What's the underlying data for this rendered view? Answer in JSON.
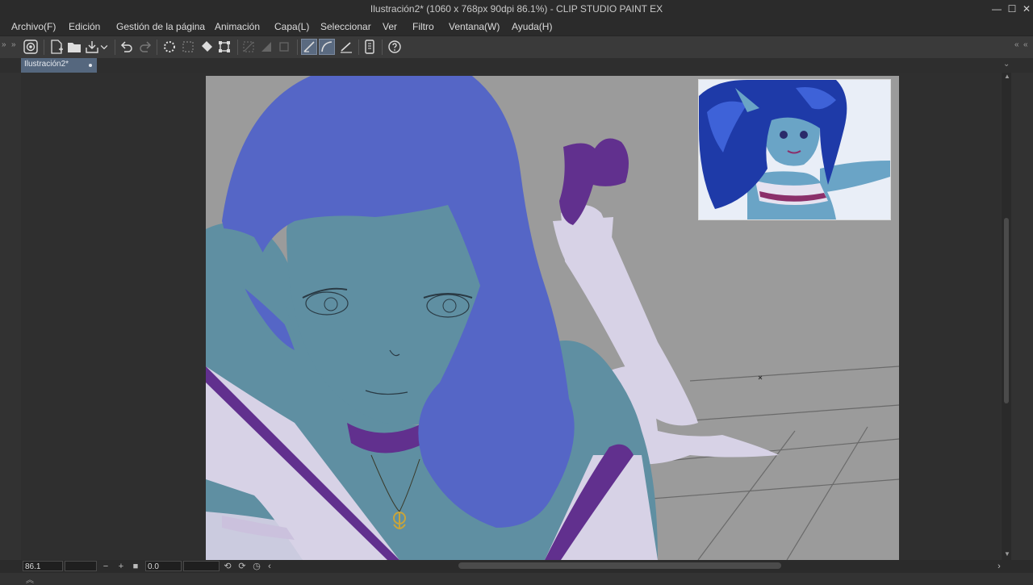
{
  "window": {
    "title": "Ilustración2* (1060 x 768px 90dpi 86.1%)  - CLIP STUDIO PAINT EX",
    "minimize": "—",
    "maximize": "☐",
    "close": "✕"
  },
  "menu": [
    "Archivo(F)",
    "Edición",
    "Gestión de la página",
    "Animación",
    "Capa(L)",
    "Seleccionar",
    "Ver",
    "Filtro",
    "Ventana(W)",
    "Ayuda(H)"
  ],
  "tabs": {
    "active": "Ilustración2*"
  },
  "status": {
    "zoom": "86.1",
    "rotation": "0.0",
    "zoom_out": "−",
    "zoom_in": "+",
    "fit": "■"
  },
  "colors": {
    "accent": "#55677e",
    "canvas_bg": "#9b9b9b",
    "hair": "#5566c6",
    "skin": "#5f8fa2",
    "cloth": "#d7d2e6",
    "trim": "#61308e"
  },
  "icons": [
    "clip-studio-icon",
    "new-file-icon",
    "open-folder-icon",
    "save-icon",
    "undo-icon",
    "redo-icon",
    "loading-icon",
    "select-icon",
    "fill-icon",
    "transform-icon",
    "snap-ruler-icon",
    "snap-curve-icon",
    "snap-grid-icon",
    "tablet-icon",
    "help-icon"
  ]
}
